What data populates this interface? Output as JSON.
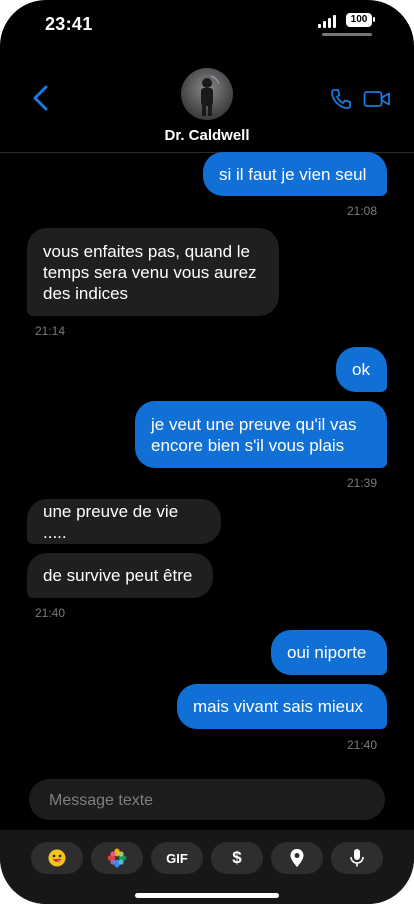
{
  "status": {
    "time": "23:41",
    "battery": "100"
  },
  "header": {
    "contact_name": "Dr. Caldwell"
  },
  "messages": [
    {
      "dir": "out",
      "text": "si il faut je vien seul"
    },
    {
      "dir": "in",
      "text": "vous enfaites pas, quand le temps sera venu vous aurez des indices"
    },
    {
      "dir": "out",
      "text": "ok"
    },
    {
      "dir": "out",
      "text": "je veut une preuve qu'il vas encore bien s'il vous plais"
    },
    {
      "dir": "in",
      "text": "une preuve de vie ....."
    },
    {
      "dir": "in",
      "text": "de survive peut être"
    },
    {
      "dir": "out",
      "text": "oui niporte"
    },
    {
      "dir": "out",
      "text": "mais vivant sais mieux"
    }
  ],
  "timestamps": [
    "21:08",
    "21:14",
    "21:39",
    "21:40",
    "21:40"
  ],
  "composer": {
    "placeholder": "Message texte"
  },
  "tray": {
    "gif_label": "GIF",
    "dollar_label": "$"
  },
  "colors": {
    "outgoing": "#1170d6",
    "incoming": "#1f1f1f",
    "accent": "#1a7ae0"
  }
}
